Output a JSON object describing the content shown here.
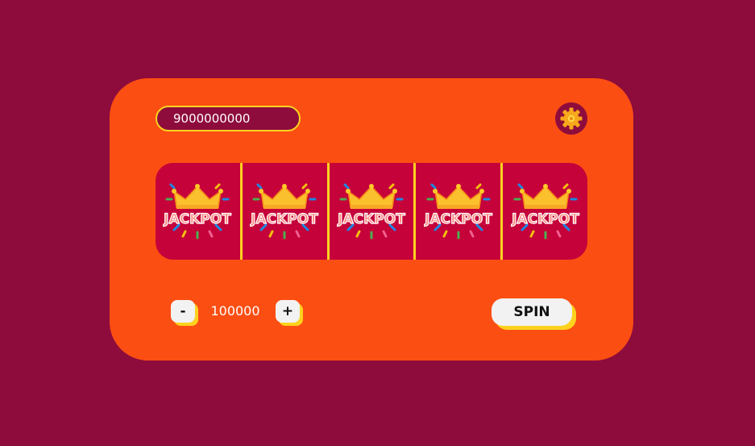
{
  "balance": {
    "value": "9000000000"
  },
  "settings": {
    "icon": "gear-icon"
  },
  "reels": {
    "symbols": [
      "JACKPOT",
      "JACKPOT",
      "JACKPOT",
      "JACKPOT",
      "JACKPOT"
    ]
  },
  "bet": {
    "decrease_label": "-",
    "increase_label": "+",
    "amount": "100000"
  },
  "spin": {
    "label": "SPIN"
  },
  "colors": {
    "background": "#8e0c3c",
    "machine": "#fb4e12",
    "reel_window": "#c5023a",
    "accent_yellow": "#fcd21f",
    "button": "#f2f2f2"
  }
}
